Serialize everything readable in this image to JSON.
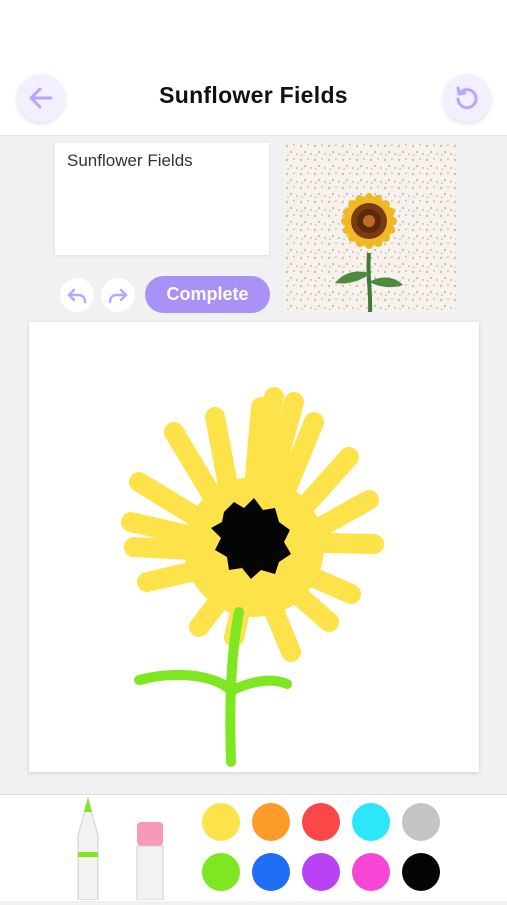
{
  "header": {
    "title": "Sunflower Fields",
    "back_icon": "arrow-left-icon",
    "reset_icon": "rotate-ccw-icon"
  },
  "editor": {
    "name_value": "Sunflower Fields",
    "undo_icon": "undo-icon",
    "redo_icon": "redo-icon",
    "complete_label": "Complete"
  },
  "theme": {
    "accent": "#a991f5",
    "icon_color": "#b9a6ff"
  },
  "palette": {
    "selected": "green",
    "colors": [
      {
        "name": "yellow",
        "hex": "#fde24a"
      },
      {
        "name": "orange",
        "hex": "#fd9b2a"
      },
      {
        "name": "red",
        "hex": "#fb4747"
      },
      {
        "name": "cyan",
        "hex": "#2ee6f9"
      },
      {
        "name": "gray",
        "hex": "#c4c4c4"
      },
      {
        "name": "green",
        "hex": "#7ee722"
      },
      {
        "name": "blue",
        "hex": "#1f6cf5"
      },
      {
        "name": "purple",
        "hex": "#b842f4"
      },
      {
        "name": "pink",
        "hex": "#f745d5"
      },
      {
        "name": "black",
        "hex": "#050505"
      }
    ]
  },
  "tools": {
    "pen_icon": "pen-icon",
    "eraser_icon": "eraser-icon"
  }
}
